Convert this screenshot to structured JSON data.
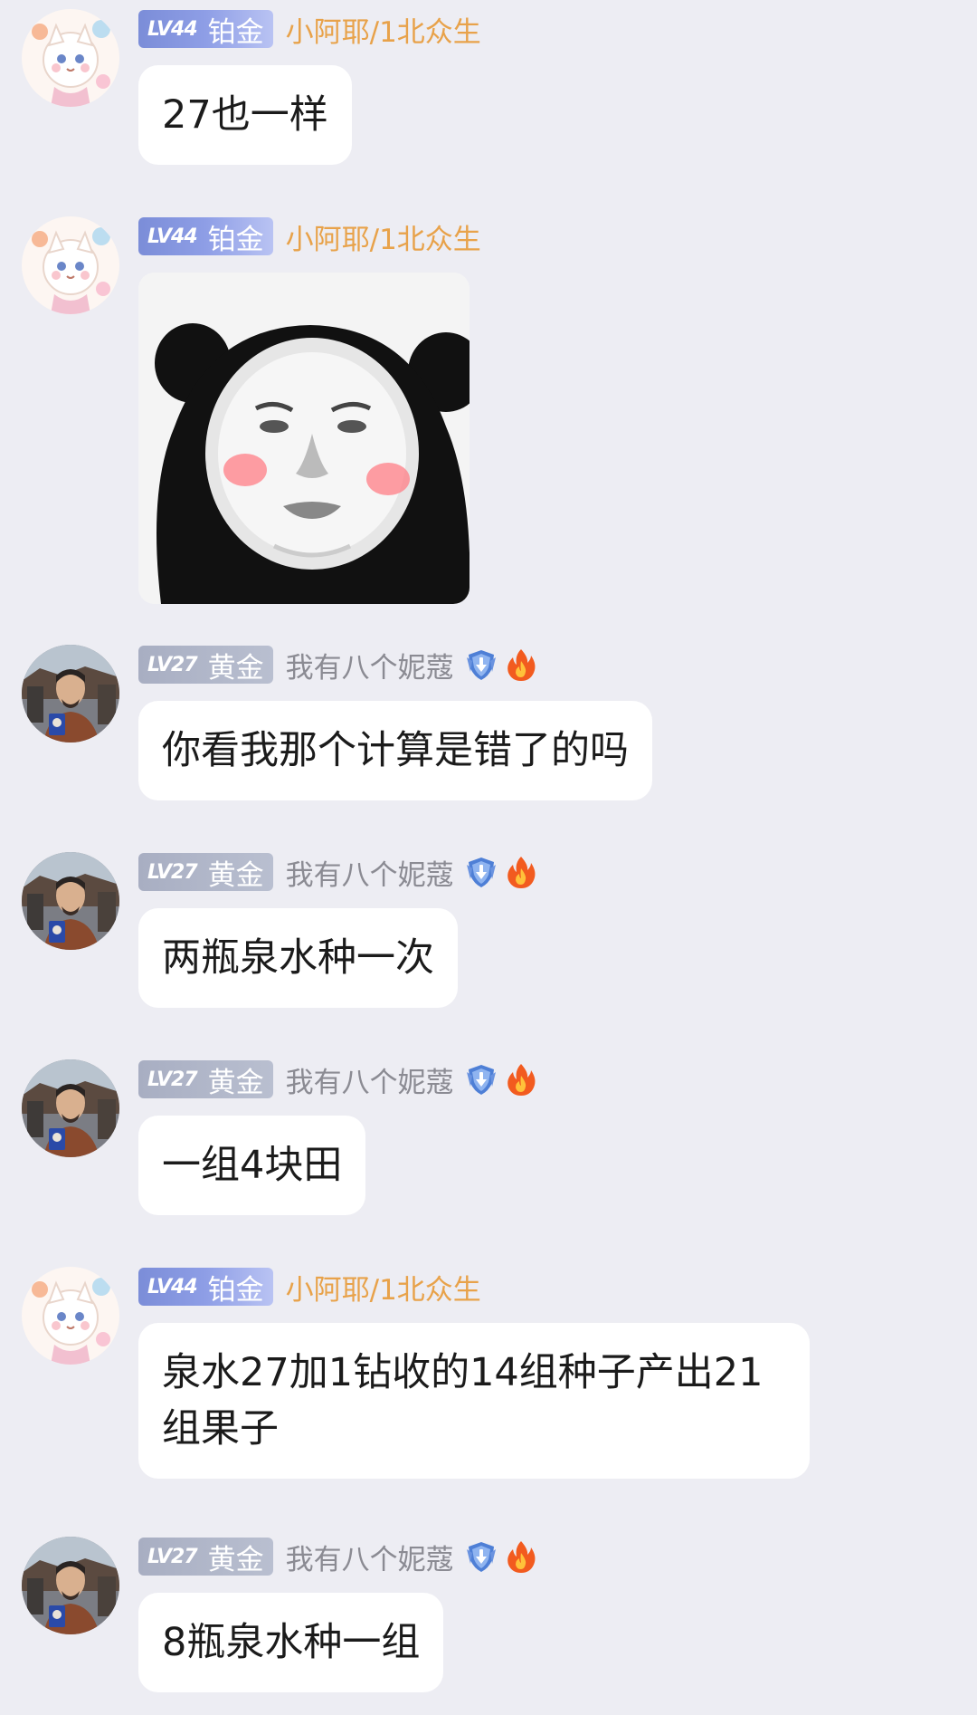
{
  "users": {
    "a": {
      "level": "LV44",
      "rank": "铂金",
      "nickname": "小阿耶/1北众生"
    },
    "b": {
      "level": "LV27",
      "rank": "黄金",
      "nickname": "我有八个妮蔻"
    }
  },
  "messages": [
    {
      "user": "a",
      "type": "text",
      "text": "27也一样"
    },
    {
      "user": "a",
      "type": "sticker",
      "sticker": "panda-face-sticker"
    },
    {
      "user": "b",
      "type": "text",
      "text": "你看我那个计算是错了的吗"
    },
    {
      "user": "b",
      "type": "text",
      "text": "两瓶泉水种一次"
    },
    {
      "user": "b",
      "type": "text",
      "text": "一组4块田"
    },
    {
      "user": "a",
      "type": "text",
      "text": "泉水27加1钻收的14组种子产出21组果子"
    },
    {
      "user": "b",
      "type": "text",
      "text": "8瓶泉水种一组"
    }
  ],
  "icons": {
    "avatar_a": "anime-cat-girl-avatar",
    "avatar_b": "man-portrait-avatar",
    "shield": "shield-badge-icon",
    "fire": "fire-icon"
  },
  "colors": {
    "background": "#ededf3",
    "bubble": "#ffffff",
    "nick_orange": "#e8a24a",
    "nick_gray": "#8b8b93",
    "platinum_badge": "#8e9ee6",
    "gold_badge": "#b4bacb"
  }
}
